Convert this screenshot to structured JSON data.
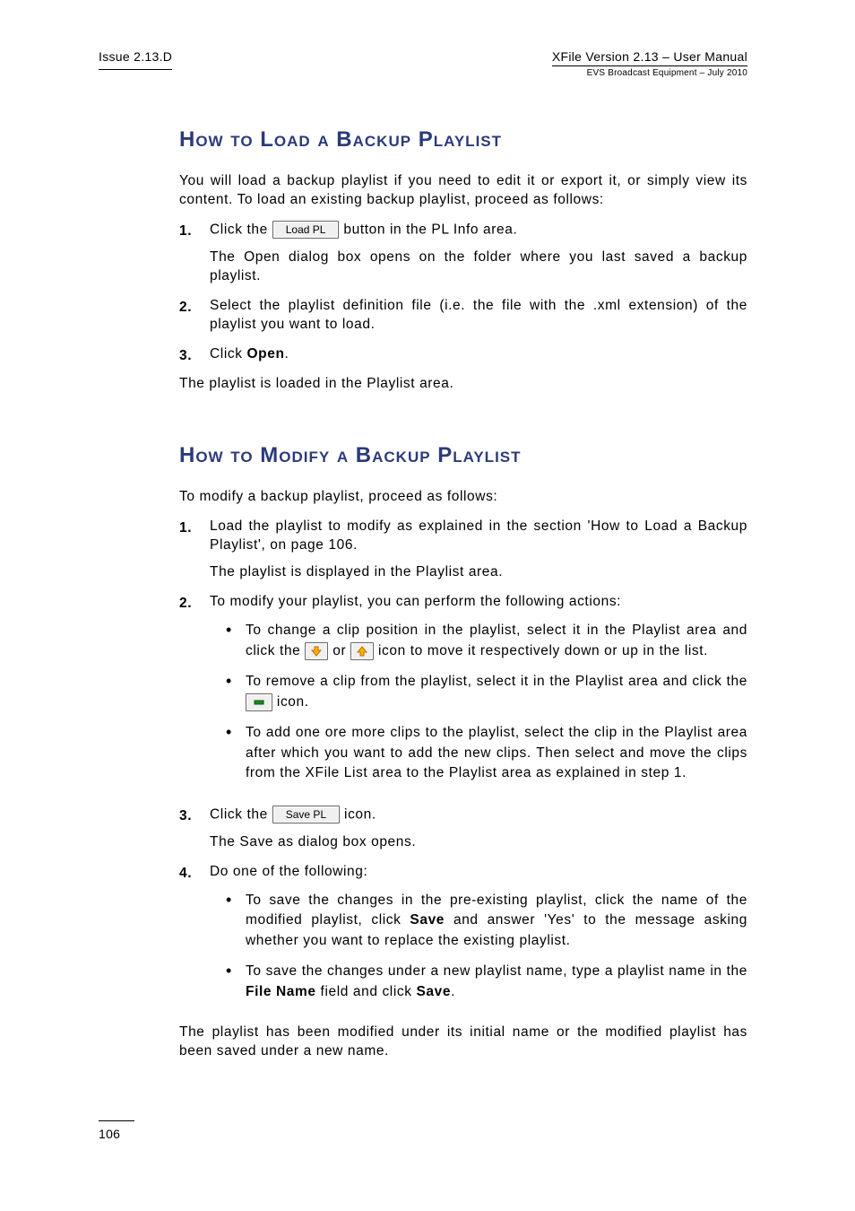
{
  "header": {
    "left": "Issue 2.13.D",
    "right_line1": "XFile Version 2.13 – User Manual",
    "right_line2": "EVS Broadcast Equipment – July 2010"
  },
  "section1": {
    "title": "How to Load a Backup Playlist",
    "intro": "You will load a backup playlist if you need to edit it or export it, or simply view its content. To load an existing backup playlist, proceed as follows:",
    "step1_a": "Click the ",
    "step1_btn": "Load PL",
    "step1_b": " button in the PL Info area.",
    "step1_p2": "The Open dialog box opens on the folder where you last saved a backup playlist.",
    "step2": "Select the playlist definition file (i.e. the file with the .xml extension) of the playlist you want to load.",
    "step3_a": "Click ",
    "step3_bold": "Open",
    "step3_b": ".",
    "outro": "The playlist is loaded in the Playlist area."
  },
  "section2": {
    "title": "How to Modify a Backup Playlist",
    "intro": "To modify a backup playlist, proceed as follows:",
    "step1_p1": "Load the playlist to modify as explained in the section 'How to Load a Backup Playlist', on page 106.",
    "step1_p2": "The playlist is displayed in the Playlist area.",
    "step2_intro": "To modify your playlist, you can perform the following actions:",
    "step2_b1_a": "To change a clip position in the playlist, select it in the Playlist area and click the ",
    "step2_b1_or": " or ",
    "step2_b1_b": " icon to move it respectively down or up in the list.",
    "step2_b2_a": "To remove a clip from the playlist, select it in the Playlist area and click the ",
    "step2_b2_b": " icon.",
    "step2_b3": "To add one ore more clips to the playlist, select the clip in the Playlist area after which you want to add the new clips. Then select and move the clips from the XFile List area to the Playlist area as explained in step 1.",
    "step3_a": "Click the  ",
    "step3_btn": "Save PL",
    "step3_b": " icon.",
    "step3_p2": "The Save as dialog box opens.",
    "step4_intro": "Do one of the following:",
    "step4_b1_a": "To save the changes in the pre-existing playlist, click the name of the modified playlist, click ",
    "step4_b1_bold1": "Save",
    "step4_b1_b": " and answer 'Yes' to the message asking whether you want to replace the existing playlist.",
    "step4_b2_a": "To save the changes under a new playlist name, type a playlist name in the ",
    "step4_b2_bold1": "File Name",
    "step4_b2_b": " field and click ",
    "step4_b2_bold2": "Save",
    "step4_b2_c": ".",
    "outro": "The playlist has been modified under its initial name or the modified playlist has been saved under a new name."
  },
  "nums": {
    "n1": "1.",
    "n2": "2.",
    "n3": "3.",
    "n4": "4."
  },
  "footer": {
    "page": "106"
  }
}
